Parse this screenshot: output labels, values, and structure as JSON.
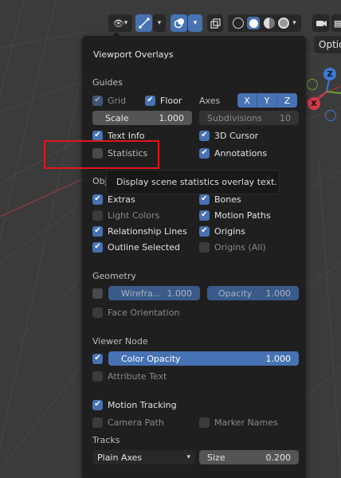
{
  "header": {
    "overlays_label": "Viewport Overlays",
    "options_label": "Optio"
  },
  "gizmo": {
    "z": "Z",
    "x": "X"
  },
  "guides": {
    "title": "Guides",
    "grid": "Grid",
    "floor": "Floor",
    "axes_label": "Axes",
    "axis_x": "X",
    "axis_y": "Y",
    "axis_z": "Z",
    "scale_label": "Scale",
    "scale_value": "1.000",
    "subdivisions_label": "Subdivisions",
    "subdivisions_value": "10",
    "text_info": "Text Info",
    "cursor_3d": "3D Cursor",
    "statistics": "Statistics",
    "annotations": "Annotations"
  },
  "tooltip": {
    "text": "Display scene statistics overlay text."
  },
  "objects": {
    "title": "Obj",
    "extras": "Extras",
    "bones": "Bones",
    "light_colors": "Light Colors",
    "motion_paths": "Motion Paths",
    "relationship_lines": "Relationship Lines",
    "origins": "Origins",
    "outline_selected": "Outline Selected",
    "origins_all": "Origins (All)"
  },
  "geometry": {
    "title": "Geometry",
    "wireframe_label": "Wirefra...",
    "wireframe_value": "1.000",
    "opacity_label": "Opacity",
    "opacity_value": "1.000",
    "face_orientation": "Face Orientation"
  },
  "viewer_node": {
    "title": "Viewer Node",
    "color_opacity_label": "Color Opacity",
    "color_opacity_value": "1.000",
    "attribute_text": "Attribute Text"
  },
  "motion_tracking": {
    "label": "Motion Tracking",
    "camera_path": "Camera Path",
    "marker_names": "Marker Names",
    "tracks_title": "Tracks",
    "tracks_select": "Plain Axes",
    "size_label": "Size",
    "size_value": "0.200"
  }
}
